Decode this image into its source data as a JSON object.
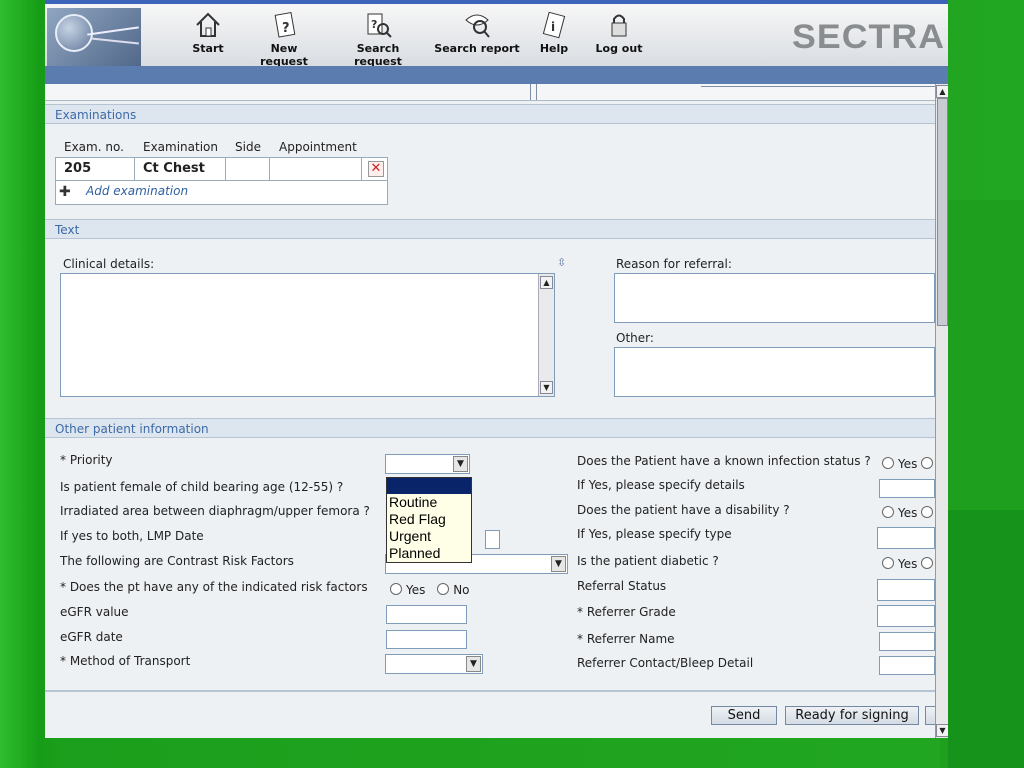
{
  "toolbar": {
    "items": [
      {
        "label": "Start",
        "icon": "home-icon"
      },
      {
        "label": "New request",
        "icon": "new-request-icon"
      },
      {
        "label": "Search request",
        "icon": "search-request-icon"
      },
      {
        "label": "Search report",
        "icon": "search-report-icon"
      },
      {
        "label": "Help",
        "icon": "help-book-icon"
      },
      {
        "label": "Log out",
        "icon": "lock-icon"
      }
    ],
    "brand": "SECTRA"
  },
  "examinations": {
    "heading": "Examinations",
    "columns": [
      "Exam. no.",
      "Examination",
      "Side",
      "Appointment"
    ],
    "rows": [
      {
        "exam_no": "205",
        "examination": "Ct Chest",
        "side": "",
        "appointment": ""
      }
    ],
    "add_label": "Add examination"
  },
  "text_section": {
    "heading": "Text",
    "clinical_details_label": "Clinical details:",
    "reason_label": "Reason for referral:",
    "other_label": "Other:"
  },
  "other_info": {
    "heading": "Other patient information",
    "left": {
      "priority": "* Priority",
      "female_child_bearing": "Is patient female of child bearing age (12-55) ?",
      "irradiated_area": "Irradiated area between diaphragm/upper femora ?",
      "lmp_date": "If yes to both, LMP Date",
      "contrast_risk": "The following are Contrast Risk Factors",
      "risk_factors": "* Does the pt have any of the indicated risk factors",
      "egfr_value": "eGFR value",
      "egfr_date": "eGFR date",
      "transport": "* Method of Transport"
    },
    "right": {
      "infection_status": "Does the Patient have a known infection status ?",
      "specify_details": "If Yes, please specify details",
      "disability": "Does the patient have a disability ?",
      "specify_type": "If Yes, please specify type",
      "diabetic": "Is the patient diabetic ?",
      "referral_status": "Referral Status",
      "referrer_grade": "* Referrer Grade",
      "referrer_name": "* Referrer Name",
      "referrer_contact": "Referrer Contact/Bleep Detail"
    },
    "radio_yes": "Yes",
    "radio_no": "No",
    "priority_options": [
      "",
      "Routine",
      "Red Flag",
      "Urgent",
      "Planned"
    ]
  },
  "footer": {
    "send": "Send",
    "ready": "Ready for signing"
  }
}
